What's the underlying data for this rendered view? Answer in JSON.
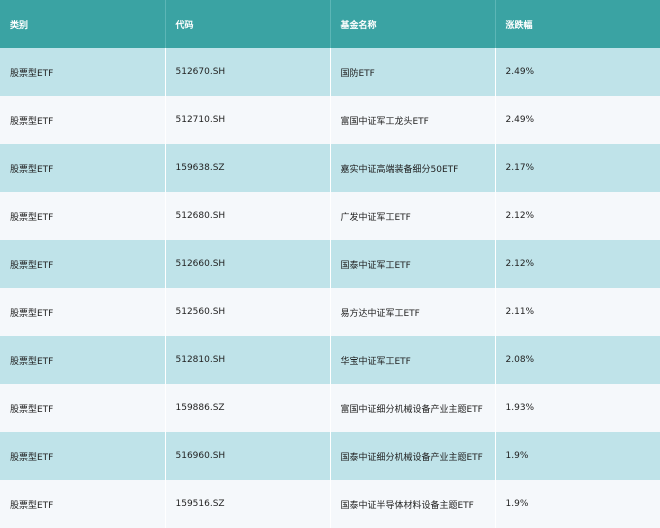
{
  "table": {
    "headers": [
      "类别",
      "代码",
      "基金名称",
      "涨跌幅"
    ],
    "rows": [
      [
        "股票型ETF",
        "512670.SH",
        "国防ETF",
        "2.49%"
      ],
      [
        "股票型ETF",
        "512710.SH",
        "富国中证军工龙头ETF",
        "2.49%"
      ],
      [
        "股票型ETF",
        "159638.SZ",
        "嘉实中证高端装备细分50ETF",
        "2.17%"
      ],
      [
        "股票型ETF",
        "512680.SH",
        "广发中证军工ETF",
        "2.12%"
      ],
      [
        "股票型ETF",
        "512660.SH",
        "国泰中证军工ETF",
        "2.12%"
      ],
      [
        "股票型ETF",
        "512560.SH",
        "易方达中证军工ETF",
        "2.11%"
      ],
      [
        "股票型ETF",
        "512810.SH",
        "华宝中证军工ETF",
        "2.08%"
      ],
      [
        "股票型ETF",
        "159886.SZ",
        "富国中证细分机械设备产业主题ETF",
        "1.93%"
      ],
      [
        "股票型ETF",
        "516960.SH",
        "国泰中证细分机械设备产业主题ETF",
        "1.9%"
      ],
      [
        "股票型ETF",
        "159516.SZ",
        "国泰中证半导体材料设备主题ETF",
        "1.9%"
      ]
    ]
  },
  "colors": {
    "header_bg": "#3aa3a3",
    "row_odd_bg": "#bfe3e9",
    "row_even_bg": "#f5f8fb"
  }
}
